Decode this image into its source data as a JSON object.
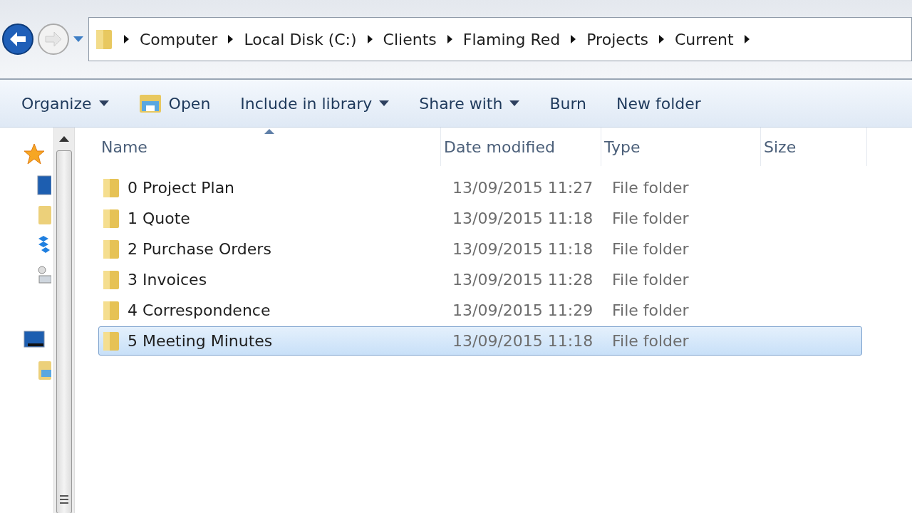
{
  "breadcrumb": [
    "Computer",
    "Local Disk (C:)",
    "Clients",
    "Flaming Red",
    "Projects",
    "Current"
  ],
  "toolbar": [
    {
      "label": "Organize",
      "kind": "menu"
    },
    {
      "label": "Open",
      "kind": "open"
    },
    {
      "label": "Include in library",
      "kind": "menu"
    },
    {
      "label": "Share with",
      "kind": "menu"
    },
    {
      "label": "Burn",
      "kind": "plain"
    },
    {
      "label": "New folder",
      "kind": "plain"
    }
  ],
  "columns": [
    {
      "label": "Name",
      "sorted": true
    },
    {
      "label": "Date modified",
      "sorted": false
    },
    {
      "label": "Type",
      "sorted": false
    },
    {
      "label": "Size",
      "sorted": false
    }
  ],
  "rows": [
    {
      "name": "0 Project Plan",
      "date": "13/09/2015 11:27",
      "type": "File folder",
      "selected": false
    },
    {
      "name": "1 Quote",
      "date": "13/09/2015 11:18",
      "type": "File folder",
      "selected": false
    },
    {
      "name": "2 Purchase Orders",
      "date": "13/09/2015 11:18",
      "type": "File folder",
      "selected": false
    },
    {
      "name": "3 Invoices",
      "date": "13/09/2015 11:28",
      "type": "File folder",
      "selected": false
    },
    {
      "name": "4 Correspondence",
      "date": "13/09/2015 11:29",
      "type": "File folder",
      "selected": false
    },
    {
      "name": "5 Meeting Minutes",
      "date": "13/09/2015 11:18",
      "type": "File folder",
      "selected": true
    }
  ]
}
